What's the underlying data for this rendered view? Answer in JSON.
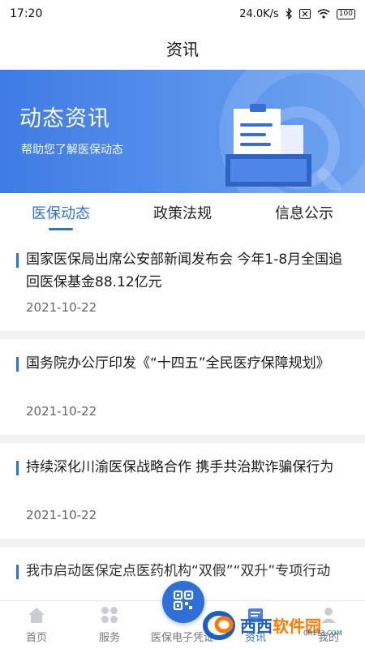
{
  "status_bar": {
    "time": "17:20",
    "network_speed": "24.0K/s",
    "battery": "100"
  },
  "header": {
    "title": "资讯"
  },
  "banner": {
    "title": "动态资讯",
    "subtitle": "帮助您了解医保动态"
  },
  "tabs": [
    {
      "label": "医保动态",
      "active": true
    },
    {
      "label": "政策法规",
      "active": false
    },
    {
      "label": "信息公示",
      "active": false
    }
  ],
  "news": [
    {
      "title": "国家医保局出席公安部新闻发布会 今年1-8月全国追回医保基金88.12亿元",
      "date": "2021-10-22"
    },
    {
      "title": "国务院办公厅印发《“十四五”全民医疗保障规划》",
      "date": "2021-10-22"
    },
    {
      "title": "持续深化川渝医保战略合作 携手共治欺诈骗保行为",
      "date": "2021-10-22"
    },
    {
      "title": "我市启动医保定点医药机构“双假”“双升”专项行动",
      "date": ""
    }
  ],
  "bottom_nav": [
    {
      "label": "首页",
      "icon": "home-icon",
      "active": false
    },
    {
      "label": "服务",
      "icon": "grid-icon",
      "active": false
    },
    {
      "label": "医保电子凭证",
      "icon": "qr-code-icon",
      "active": false
    },
    {
      "label": "资讯",
      "icon": "news-icon",
      "active": true
    },
    {
      "label": "我的",
      "icon": "user-icon",
      "active": false
    }
  ],
  "watermark": {
    "text_blue": "西西",
    "text_orange": "软件园",
    "url": "CR173.COM"
  },
  "colors": {
    "accent": "#2f6fd8",
    "banner_start": "#3e7be4",
    "divider": "#f1f2f4"
  }
}
